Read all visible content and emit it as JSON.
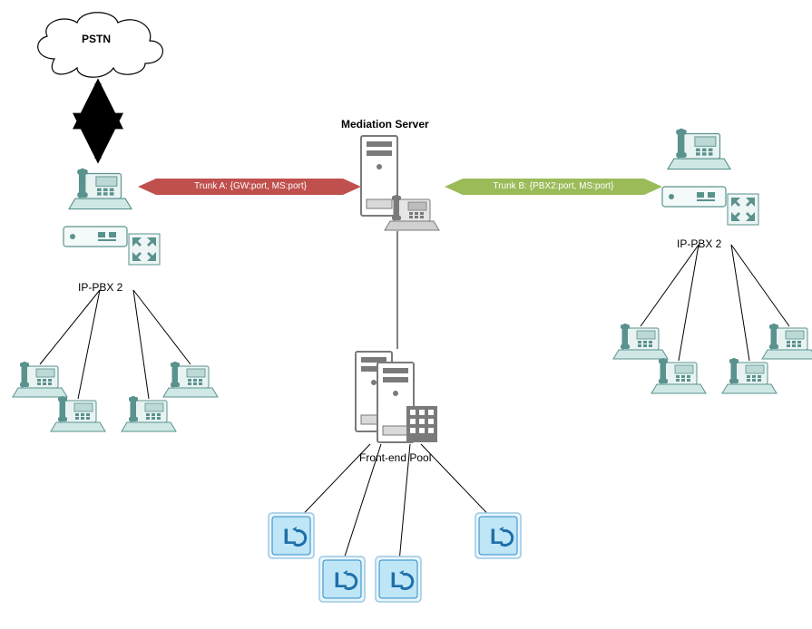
{
  "pstn": {
    "label": "PSTN"
  },
  "mediation": {
    "label": "Mediation Server"
  },
  "ippbx_left": {
    "label": "IP-PBX 2"
  },
  "ippbx_right": {
    "label": "IP-PBX 2"
  },
  "frontend": {
    "label": "Front-end Pool"
  },
  "trunk_a": {
    "label": "Trunk A: {GW:port, MS:port}"
  },
  "trunk_b": {
    "label": "Trunk B: {PBX2:port, MS:port}"
  },
  "colors": {
    "red": "#c0504d",
    "green": "#9bbb59",
    "gray": "#7a7a7a",
    "black": "#000000",
    "teal": "#5a928e",
    "lyncLight": "#bee6f7",
    "lyncBorder": "#2f89c4",
    "lyncDark": "#1f6fa8"
  }
}
